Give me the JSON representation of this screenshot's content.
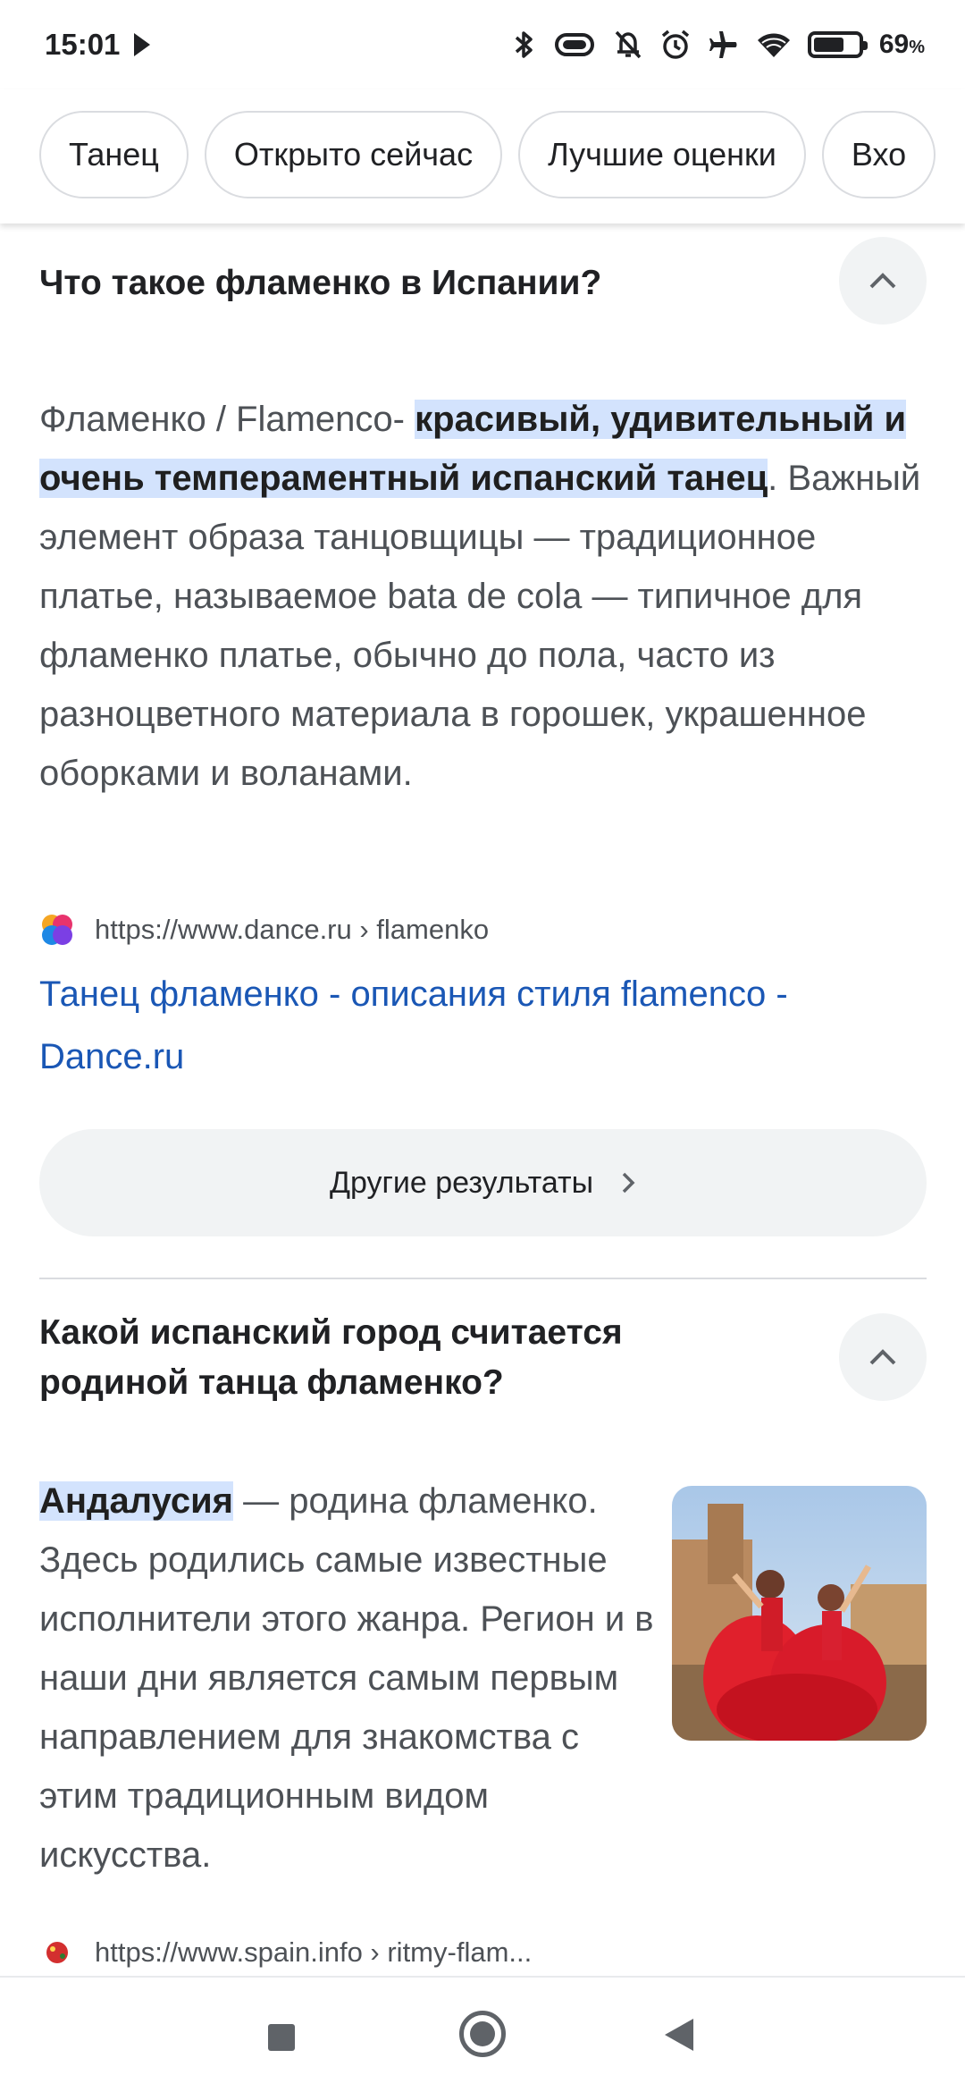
{
  "status_bar": {
    "time": "15:01",
    "battery_percent_value": "69",
    "battery_percent_sign": "%",
    "battery_level": 0.69,
    "icons": [
      "play-icon",
      "bluetooth-icon",
      "vibrate-icon",
      "bell-off-icon",
      "alarm-icon",
      "airplane-icon",
      "wifi-icon",
      "battery-icon"
    ]
  },
  "chips": [
    {
      "label": "Танец"
    },
    {
      "label": "Открыто сейчас"
    },
    {
      "label": "Лучшие оценки"
    },
    {
      "label": "Вхо"
    }
  ],
  "faq": [
    {
      "question": "Что такое фламенко в Испании?",
      "answer_prefix": "Фламенко / Flamenco- ",
      "answer_highlight": "красивый, удивительный и очень темпераментный испанский танец",
      "answer_suffix": ". Важный элемент образа танцовщицы — традиционное платье, называемое bata de cola — типичное для фламенко платье, обычно до пола, часто из разноцветного материала в горошек, украшенное оборками и воланами.",
      "source_url": "https://www.dance.ru › flamenko",
      "result_title": "Танец фламенко - описания стиля flamenco - Dance.ru",
      "more_label": "Другие результаты"
    },
    {
      "question": "Какой испанский город считается родиной танца фламенко?",
      "answer_highlight": "Андалусия",
      "answer_suffix": " — родина фламенко. Здесь родились самые известные исполнители этого жанра. Регион и в наши дни является самым первым направлением для знакомства с этим традиционным видом искусства.",
      "source_url": "https://www.spain.info › ritmy-flam..."
    }
  ],
  "colors": {
    "link": "#1a57b5",
    "highlight": "#d3e3fd",
    "chip_border": "#dadce0"
  }
}
